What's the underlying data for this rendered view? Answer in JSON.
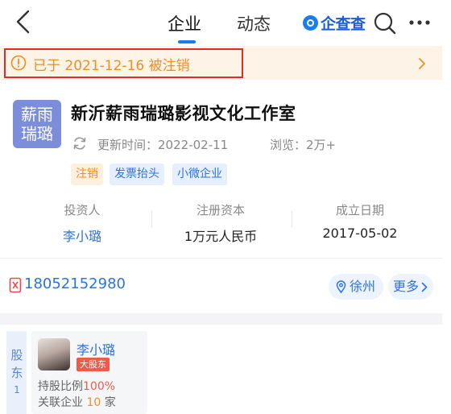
{
  "nav": {
    "tabs": [
      "企业",
      "动态"
    ],
    "active_tab": "企业",
    "brand": "企查查"
  },
  "notice": {
    "text": "已于 2021-12-16 被注销"
  },
  "company": {
    "logo_line1": "薪雨",
    "logo_line2": "瑞璐",
    "name": "新沂薪雨瑞璐影视文化工作室",
    "updated_label": "更新时间：",
    "updated_value": "2022-02-11",
    "views_label": "浏览：",
    "views_value": "2万+",
    "tags": [
      "注销",
      "发票抬头",
      "小微企业"
    ]
  },
  "stats": [
    {
      "label": "投资人",
      "value": "李小璐"
    },
    {
      "label": "注册资本",
      "value": "1万元人民币"
    },
    {
      "label": "成立日期",
      "value": "2017-05-02"
    }
  ],
  "contact": {
    "phone": "18052152980",
    "location": "徐州",
    "more": "更多"
  },
  "shareholders": {
    "label": "股东",
    "count": "1",
    "items": [
      {
        "name": "李小璐",
        "badge": "大股东",
        "share_label": "持股比例",
        "share_value": "100%",
        "related_label": "关联企业",
        "related_value": "10",
        "related_unit": "家"
      }
    ]
  },
  "colors": {
    "accent": "#1a7cf2",
    "link": "#2c72e0",
    "warning": "#ee8f25",
    "highlight_box": "#e22a2a",
    "badge": "#f05a4a"
  }
}
